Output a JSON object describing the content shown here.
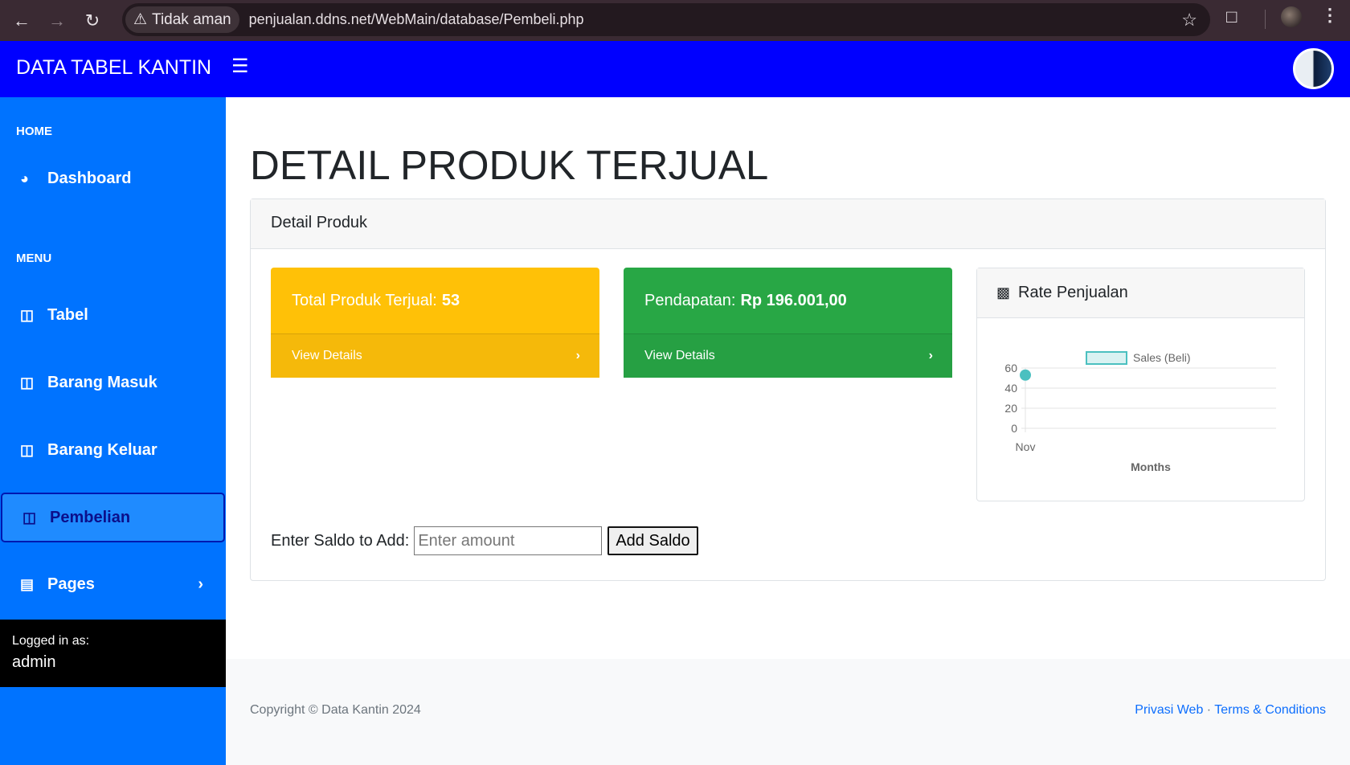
{
  "browser": {
    "security_label": "Tidak aman",
    "url": "penjualan.ddns.net/WebMain/database/Pembeli.php"
  },
  "navbar": {
    "brand": "DATA TABEL KANTIN"
  },
  "sidebar": {
    "heading_home": "HOME",
    "heading_menu": "MENU",
    "items": [
      {
        "label": "Dashboard",
        "icon": "gauge-icon"
      },
      {
        "label": "Tabel",
        "icon": "table-icon"
      },
      {
        "label": "Barang Masuk",
        "icon": "table-icon"
      },
      {
        "label": "Barang Keluar",
        "icon": "table-icon"
      },
      {
        "label": "Pembelian",
        "icon": "table-icon",
        "active": true
      },
      {
        "label": "Pages",
        "icon": "book-icon"
      }
    ],
    "footer": {
      "logged_in_label": "Logged in as:",
      "username": "admin"
    }
  },
  "main": {
    "page_title": "DETAIL PRODUK TERJUAL",
    "card_title": "Detail Produk",
    "stats": [
      {
        "label": "Total Produk Terjual:",
        "value": "53",
        "link": "View Details",
        "color": "#ffc107"
      },
      {
        "label": "Pendapatan:",
        "value": "Rp 196.001,00",
        "link": "View Details",
        "color": "#28a745"
      }
    ],
    "chart_card_title": "Rate Penjualan",
    "saldo": {
      "label": "Enter Saldo to Add:",
      "placeholder": "Enter amount",
      "button": "Add Saldo"
    }
  },
  "chart_data": {
    "type": "line",
    "categories": [
      "Nov"
    ],
    "series": [
      {
        "name": "Sales (Beli)",
        "values": [
          53
        ],
        "color": "#4bc0c0"
      }
    ],
    "xlabel": "Months",
    "ylabel": "",
    "ylim": [
      0,
      60
    ],
    "yticks": [
      "60",
      "40",
      "20",
      "0"
    ],
    "grid": true,
    "legend": "top"
  },
  "footer": {
    "copyright": "Copyright © Data Kantin 2024",
    "link_privacy": "Privasi Web",
    "separator": "·",
    "link_terms": "Terms & Conditions"
  }
}
